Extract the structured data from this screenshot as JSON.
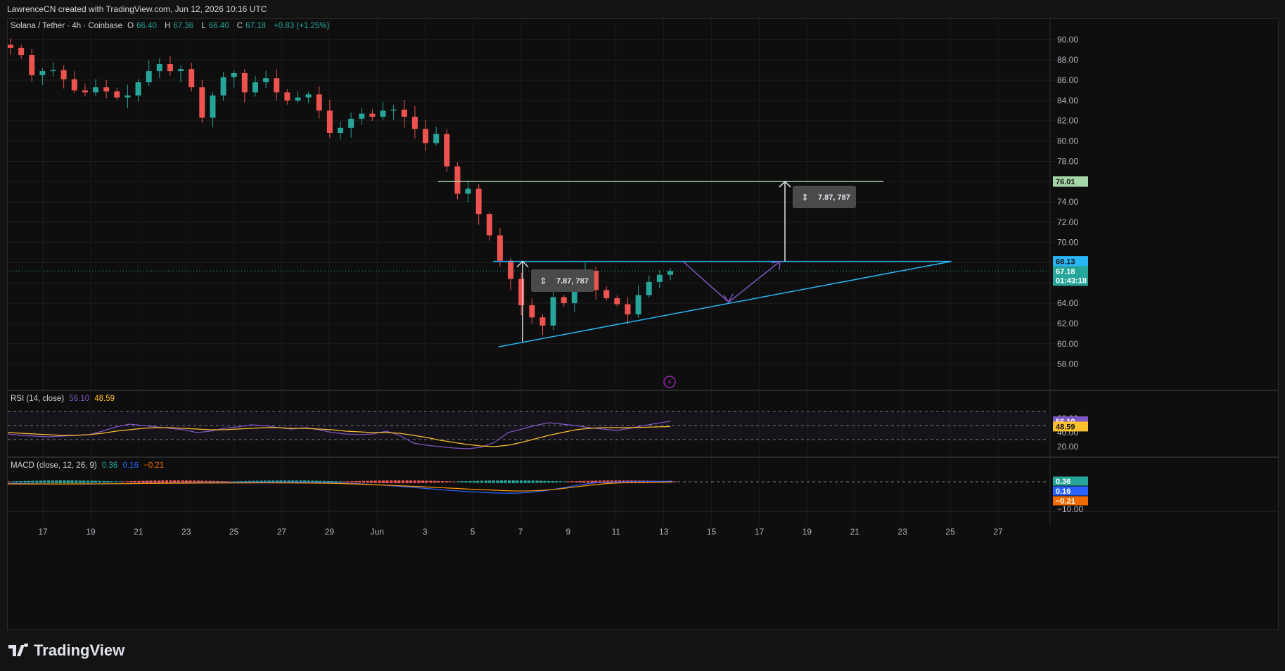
{
  "header": {
    "attribution": "LawrenceCN created with TradingView.com, Jun 12, 2026 10:16 UTC"
  },
  "legend": {
    "symbol": "Solana / Tether · 4h · Coinbase",
    "o_label": "O",
    "o_value": "66.40",
    "h_label": "H",
    "h_value": "67.36",
    "l_label": "L",
    "l_value": "66.40",
    "c_label": "C",
    "c_value": "67.18",
    "change": "+0.83 (+1.25%)"
  },
  "rsi_legend": {
    "label": "RSI (14, close)",
    "rsi": "56.10",
    "ma": "48.59"
  },
  "macd_legend": {
    "label": "MACD (close, 12, 26, 9)",
    "macd": "0.36",
    "signal": "0.16",
    "hist": "−0.21"
  },
  "footer": {
    "brand": "TradingView"
  },
  "colors": {
    "up": "#26a69a",
    "down": "#ef5350",
    "target": "#a5d6a7",
    "resistance": "#29b6f6",
    "projection": "#7e57c2",
    "rsi": "#7e57c2",
    "rsi_ma": "#fbc02d"
  },
  "chart_data": [
    {
      "type": "candlestick",
      "title": "Solana / Tether · 4h · Coinbase",
      "y_ticks": [
        "90.00",
        "88.00",
        "86.00",
        "84.00",
        "82.00",
        "80.00",
        "78.00",
        "76.00",
        "74.00",
        "72.00",
        "70.00",
        "68.00",
        "66.00",
        "64.00",
        "62.00",
        "60.00",
        "58.00"
      ],
      "ylim": [
        57,
        91
      ],
      "x_ticks": [
        "17",
        "19",
        "21",
        "23",
        "25",
        "27",
        "29",
        "Jun",
        "3",
        "5",
        "7",
        "9",
        "11",
        "13",
        "15",
        "17",
        "19",
        "21",
        "23",
        "25",
        "27"
      ],
      "price_path": [
        89.2,
        88.5,
        86.5,
        86.9,
        87.0,
        86.1,
        85.0,
        84.8,
        85.3,
        84.9,
        84.3,
        84.5,
        85.8,
        86.9,
        87.6,
        86.9,
        87.1,
        85.3,
        82.3,
        84.5,
        86.3,
        86.7,
        84.8,
        85.8,
        86.2,
        84.8,
        84.0,
        84.3,
        84.6,
        83.0,
        80.8,
        81.3,
        82.2,
        82.7,
        82.4,
        83.0,
        83.1,
        82.4,
        81.2,
        79.8,
        80.7,
        77.5,
        74.8,
        75.3,
        72.8,
        70.7,
        68.2,
        66.4,
        63.8,
        62.6,
        61.8,
        64.6,
        64.0,
        66.1,
        67.2,
        65.3,
        64.5,
        63.9,
        62.9,
        64.8,
        66.1,
        66.8,
        67.18
      ],
      "last_price": "67.18",
      "countdown": "01:43:18",
      "lines": {
        "target": "76.01",
        "resistance": "68.13"
      },
      "annotations": [
        "7.87, 787",
        "7.87, 787"
      ]
    },
    {
      "type": "line",
      "title": "RSI (14, close)",
      "y_ticks": [
        "60.00",
        "40.00",
        "20.00"
      ],
      "bands": [
        70,
        50,
        30
      ],
      "series": [
        {
          "name": "RSI",
          "values": [
            38,
            36,
            35,
            34,
            35,
            36,
            37,
            42,
            48,
            52,
            50,
            48,
            46,
            44,
            40,
            42,
            46,
            48,
            51,
            50,
            47,
            45,
            47,
            44,
            40,
            38,
            37,
            38,
            42,
            36,
            25,
            22,
            20,
            18,
            17,
            19,
            26,
            40,
            45,
            50,
            54,
            52,
            50,
            47,
            45,
            43,
            46,
            50,
            53,
            56.1
          ]
        },
        {
          "name": "RSI MA",
          "values": [
            40,
            39,
            38,
            37,
            36,
            36,
            37,
            39,
            42,
            44,
            46,
            47,
            47,
            46,
            45,
            44,
            44,
            45,
            46,
            47,
            47,
            46,
            46,
            45,
            44,
            42,
            41,
            40,
            40,
            39,
            36,
            33,
            29,
            26,
            23,
            21,
            20,
            22,
            26,
            31,
            36,
            40,
            44,
            46,
            47,
            47,
            47,
            47.5,
            48,
            48.59
          ]
        }
      ],
      "values": {
        "rsi": "56.10",
        "ma": "48.59"
      }
    },
    {
      "type": "bar",
      "title": "MACD (close, 12, 26, 9)",
      "y_ticks": [
        "−10.00"
      ],
      "values": {
        "macd": "0.36",
        "signal": "0.16",
        "hist": "−0.21"
      }
    }
  ]
}
